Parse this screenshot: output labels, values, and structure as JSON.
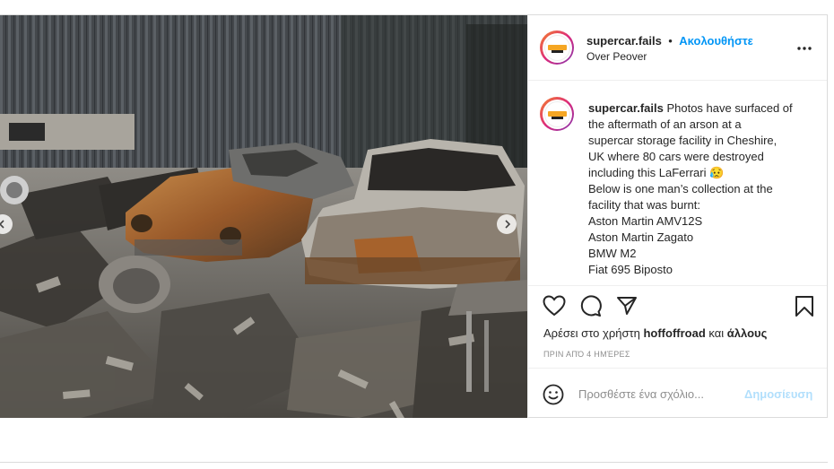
{
  "post": {
    "image": {
      "alt_description": "Burnt cars in a fire-damaged storage facility"
    },
    "header": {
      "username": "supercar.fails",
      "separator": "•",
      "follow_label": "Ακολουθήστε",
      "location": "Over Peover",
      "more_icon": "more-horizontal-icon"
    },
    "caption": {
      "username": "supercar.fails",
      "lines": [
        "Photos have surfaced of",
        "the aftermath of an arson at a",
        "supercar storage facility in Cheshire,",
        "UK where 80 cars were destroyed",
        "including this LaFerrari 😥",
        "Below is one man’s collection at the",
        "facility that was burnt:",
        "Aston Martin AMV12S",
        "Aston Martin Zagato",
        "BMW M2",
        "Fiat 695 Biposto"
      ]
    },
    "actions": {
      "like_icon": "heart-icon",
      "comment_icon": "comment-icon",
      "share_icon": "send-icon",
      "save_icon": "bookmark-icon"
    },
    "likes": {
      "prefix": "Αρέσει στο χρήστη",
      "user": "hoffoffroad",
      "connector": "και",
      "others": "άλλους"
    },
    "timestamp": "ΠΡΙΝ ΑΠΌ 4 ΗΜΈΡΕΣ",
    "comment": {
      "emoji_icon": "smiley-icon",
      "placeholder": "Προσθέστε ένα σχόλιο...",
      "post_label": "Δημοσίευση"
    }
  },
  "colors": {
    "link_blue": "#0095f6",
    "post_disabled": "#b2dffc",
    "muted": "#8e8e8e",
    "text": "#262626"
  }
}
